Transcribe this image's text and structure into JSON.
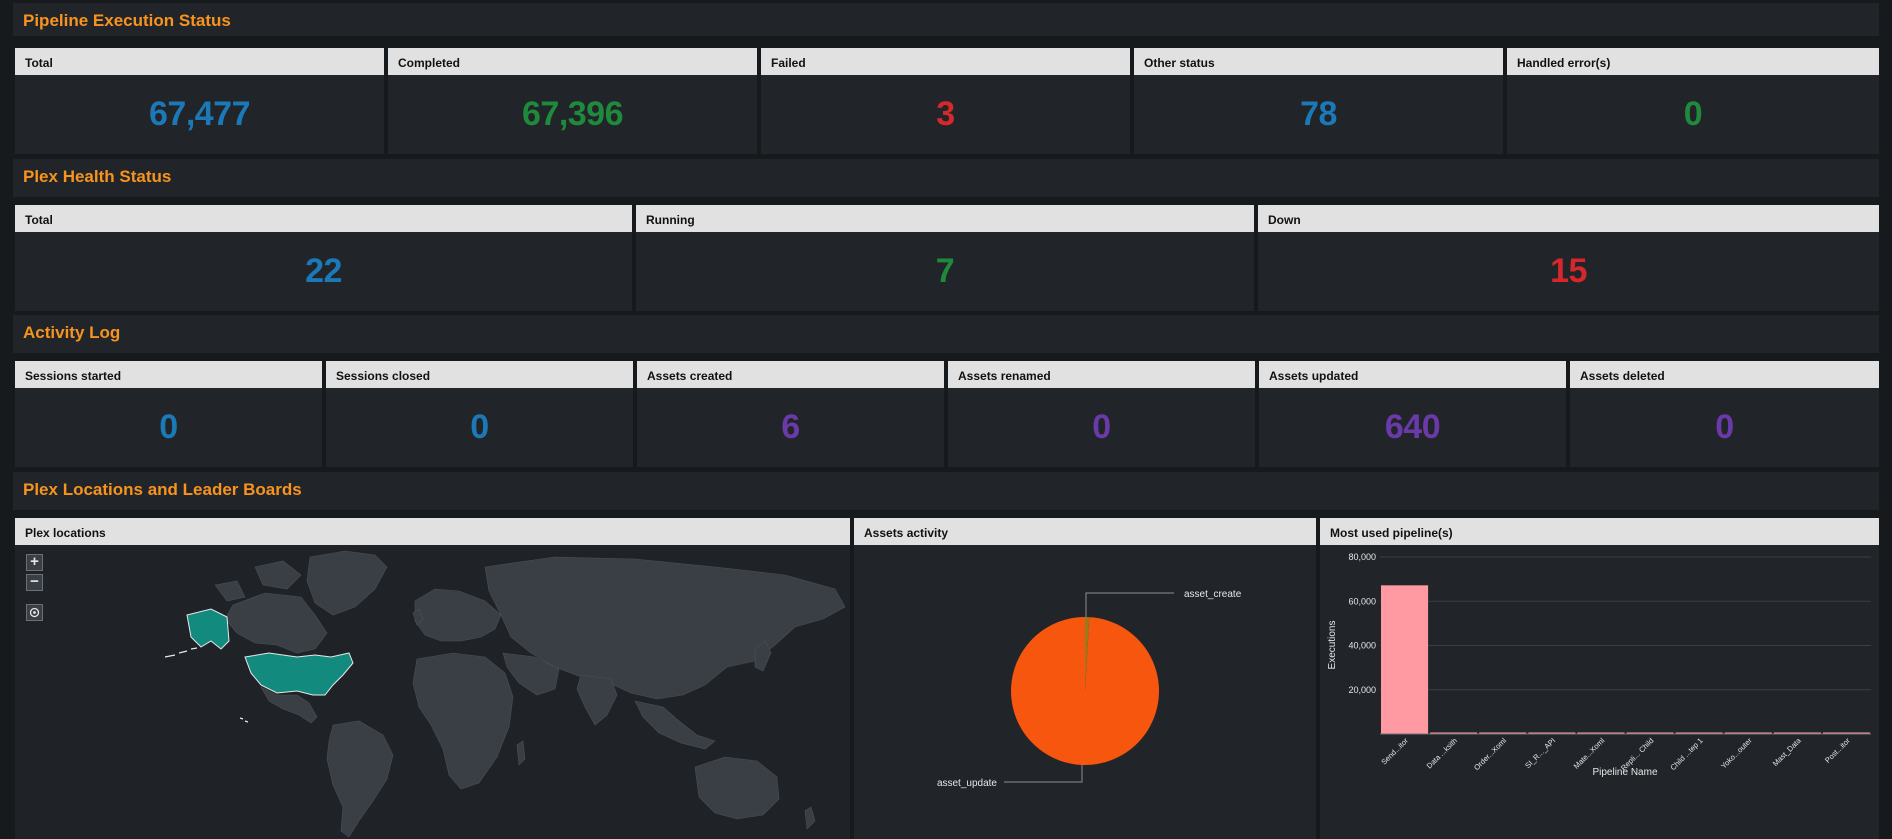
{
  "colors": {
    "section_title": "#f7931e",
    "blue": "#1c79b8",
    "green": "#1f8a3c",
    "red": "#d6282c",
    "purple": "#6a3aa8",
    "pie_update": "#f7560f",
    "pie_create": "#9a7a1a",
    "bar": "#ff9aa2",
    "highlight_country": "#138a7e"
  },
  "sections": {
    "pipeline": "Pipeline Execution Status",
    "health": "Plex Health Status",
    "activity": "Activity Log",
    "locations": "Plex Locations and Leader Boards"
  },
  "pipeline_panels": [
    {
      "label": "Total",
      "value": "67,477",
      "color": "blue"
    },
    {
      "label": "Completed",
      "value": "67,396",
      "color": "green"
    },
    {
      "label": "Failed",
      "value": "3",
      "color": "red"
    },
    {
      "label": "Other status",
      "value": "78",
      "color": "blue"
    },
    {
      "label": "Handled error(s)",
      "value": "0",
      "color": "green"
    }
  ],
  "health_panels": [
    {
      "label": "Total",
      "value": "22",
      "color": "blue"
    },
    {
      "label": "Running",
      "value": "7",
      "color": "green"
    },
    {
      "label": "Down",
      "value": "15",
      "color": "red"
    }
  ],
  "activity_panels": [
    {
      "label": "Sessions started",
      "value": "0",
      "color": "blue"
    },
    {
      "label": "Sessions closed",
      "value": "0",
      "color": "blue"
    },
    {
      "label": "Assets created",
      "value": "6",
      "color": "purple"
    },
    {
      "label": "Assets renamed",
      "value": "0",
      "color": "purple"
    },
    {
      "label": "Assets updated",
      "value": "640",
      "color": "purple"
    },
    {
      "label": "Assets deleted",
      "value": "0",
      "color": "purple"
    }
  ],
  "map_panel": {
    "title": "Plex locations",
    "controls": {
      "zoom_in": "+",
      "zoom_out": "−",
      "locate_icon": "crosshair-icon"
    },
    "highlighted_regions": [
      "United States",
      "Alaska"
    ]
  },
  "assets_panel": {
    "title": "Assets activity",
    "slices": [
      {
        "label": "asset_update",
        "value": 640
      },
      {
        "label": "asset_create",
        "value": 6
      }
    ]
  },
  "pipelines_panel": {
    "title": "Most used pipeline(s)"
  },
  "chart_data": {
    "type": "bar",
    "xlabel": "Pipeline Name",
    "ylabel": "Executions",
    "ylim": [
      0,
      80000
    ],
    "yticks": [
      "20,000",
      "40,000",
      "60,000",
      "80,000"
    ],
    "ytick_values": [
      20000,
      40000,
      60000,
      80000
    ],
    "grid": true,
    "categories": [
      "Send...itor",
      "Data ...ksith",
      "Order...Xoml",
      "SI_R..._API",
      "Mate...Xoml",
      "Repli... Child",
      "Child ...tep 1",
      "Yoko...outer",
      "Mast_Data",
      "Post...itor"
    ],
    "values": [
      67200,
      150,
      100,
      80,
      60,
      50,
      40,
      30,
      25,
      20
    ]
  }
}
